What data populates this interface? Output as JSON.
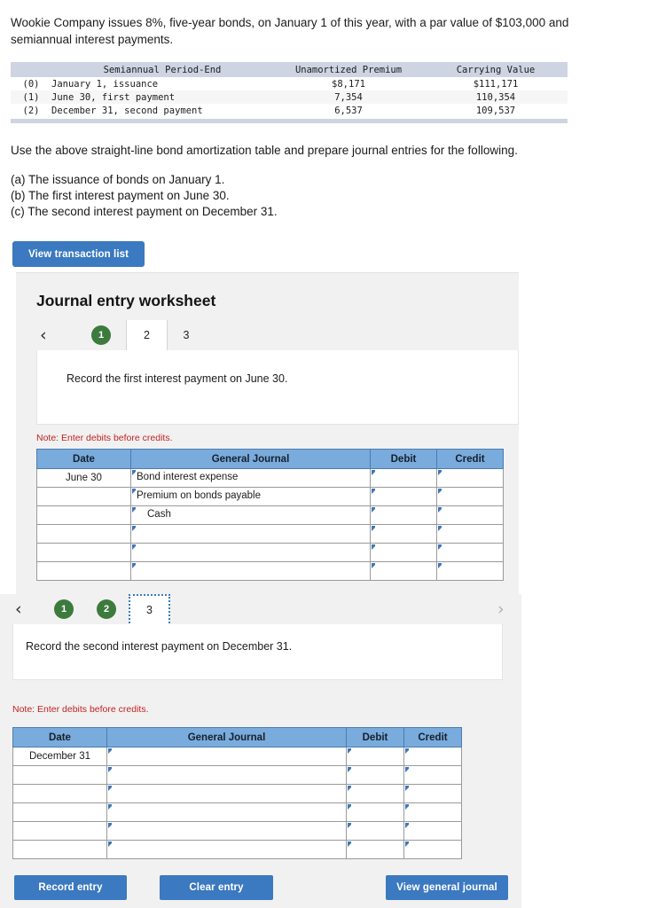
{
  "problem": {
    "statement": "Wookie Company issues 8%, five-year bonds, on January 1 of this year, with a par value of $103,000 and semiannual interest payments."
  },
  "amortization_table": {
    "headers": {
      "index": "",
      "period_end": "Semiannual Period-End",
      "unamortized_premium": "Unamortized Premium",
      "carrying_value": "Carrying Value"
    },
    "rows": [
      {
        "index": "(0)",
        "period_end": "January 1, issuance",
        "unamortized_premium": "$8,171",
        "carrying_value": "$111,171"
      },
      {
        "index": "(1)",
        "period_end": "June 30, first payment",
        "unamortized_premium": "7,354",
        "carrying_value": "110,354"
      },
      {
        "index": "(2)",
        "period_end": "December 31, second payment",
        "unamortized_premium": "6,537",
        "carrying_value": "109,537"
      }
    ]
  },
  "instruction": {
    "lead": "Use the above straight-line bond amortization table and prepare journal entries for the following.",
    "items": [
      "(a) The issuance of bonds on January 1.",
      "(b) The first interest payment on June 30.",
      "(c) The second interest payment on December 31."
    ]
  },
  "buttons": {
    "view_transaction_list": "View transaction list",
    "record_entry": "Record entry",
    "clear_entry": "Clear entry",
    "view_general_journal": "View general journal"
  },
  "worksheet": {
    "title": "Journal entry worksheet",
    "note": "Note: Enter debits before credits.",
    "prev_arrow": "‹",
    "next_arrow": "›"
  },
  "section1": {
    "tabs": [
      {
        "label": "1",
        "state": "completed"
      },
      {
        "label": "2",
        "state": "active"
      },
      {
        "label": "3",
        "state": "pending"
      }
    ],
    "prompt": "Record the first interest payment on June 30.",
    "note": "Note: Enter debits before credits.",
    "table": {
      "headers": [
        "Date",
        "General Journal",
        "Debit",
        "Credit"
      ],
      "rows": [
        {
          "date": "June 30",
          "account": "Bond interest expense",
          "indent": false,
          "debit": "",
          "credit": ""
        },
        {
          "date": "",
          "account": "Premium on bonds payable",
          "indent": false,
          "debit": "",
          "credit": ""
        },
        {
          "date": "",
          "account": "Cash",
          "indent": true,
          "debit": "",
          "credit": ""
        },
        {
          "date": "",
          "account": "",
          "indent": false,
          "debit": "",
          "credit": ""
        },
        {
          "date": "",
          "account": "",
          "indent": false,
          "debit": "",
          "credit": ""
        },
        {
          "date": "",
          "account": "",
          "indent": false,
          "debit": "",
          "credit": ""
        }
      ]
    }
  },
  "section2": {
    "tabs": [
      {
        "label": "1",
        "state": "completed"
      },
      {
        "label": "2",
        "state": "completed"
      },
      {
        "label": "3",
        "state": "active-focused"
      }
    ],
    "prompt": "Record the second interest payment on December 31.",
    "note": "Note: Enter debits before credits.",
    "table": {
      "headers": [
        "Date",
        "General Journal",
        "Debit",
        "Credit"
      ],
      "rows": [
        {
          "date": "December 31",
          "account": "",
          "indent": false,
          "debit": "",
          "credit": ""
        },
        {
          "date": "",
          "account": "",
          "indent": false,
          "debit": "",
          "credit": ""
        },
        {
          "date": "",
          "account": "",
          "indent": false,
          "debit": "",
          "credit": ""
        },
        {
          "date": "",
          "account": "",
          "indent": false,
          "debit": "",
          "credit": ""
        },
        {
          "date": "",
          "account": "",
          "indent": false,
          "debit": "",
          "credit": ""
        },
        {
          "date": "",
          "account": "",
          "indent": false,
          "debit": "",
          "credit": ""
        }
      ]
    }
  },
  "colors": {
    "button_blue": "#3b79c0",
    "table_header_blue": "#7aabdd",
    "amort_header": "#ced4e2",
    "tab_green": "#3d7a3d",
    "note_red": "#c32222"
  }
}
